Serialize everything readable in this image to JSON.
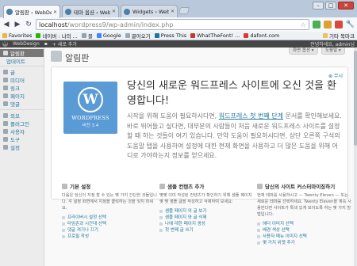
{
  "browser": {
    "tabs": [
      {
        "label": "알림판 ‹ WebDesign",
        "active": true
      },
      {
        "label": "테마 옵션 ‹ WebDe",
        "active": false
      },
      {
        "label": "Widgets ‹ WebDes",
        "active": false
      }
    ],
    "url_host": "localhost",
    "url_path": "/wordpress9/wp-admin/index.php",
    "bookmarks": [
      {
        "label": "Favorites",
        "color": "#e8b63a"
      },
      {
        "label": "네이버 : 나의 ...",
        "color": "#2db400"
      },
      {
        "label": "블",
        "color": "#8fa1b3"
      },
      {
        "label": "Google",
        "color": "#4285f4"
      },
      {
        "label": "끌어오기",
        "color": "#9aa6b2"
      },
      {
        "label": "Press This",
        "color": "#21759b"
      },
      {
        "label": "WhatTheFont! ...",
        "color": "#c0392b"
      },
      {
        "label": "dafont.com",
        "color": "#d63b2f"
      }
    ],
    "other_bookmarks": "기타 북마크"
  },
  "adminbar": {
    "site": "WebDesign",
    "new": "+ 새로 추가",
    "greeting": "안녕하세요, admin님"
  },
  "sidebar": {
    "dashboard": "알림판",
    "updates": "업데이트",
    "items": [
      "글",
      "미디어",
      "링크",
      "페이지",
      "댓글"
    ],
    "items2": [
      "외모",
      "플러그인",
      "사용자",
      "도구",
      "설정"
    ]
  },
  "header": {
    "title": "알림판",
    "screen_options": "화면 옵션 ▾",
    "help": "도움말 ▾"
  },
  "welcome": {
    "dismiss": "⊗ 무시",
    "logo_name": "WORDPRESS",
    "logo_version": "버전 3.4",
    "title": "당신의 새로운 워드프레스 사이트에 오신 것을 환영합니다!",
    "about_1": "시작을 위해 도움이 필요하시다면, ",
    "about_link": "워드프레스 첫 번째 단계",
    "about_2": " 문서를 확인해보세요. 바로 뛰어들고 싶다면, 대부분의 사람들이 처음 새로운 워드프레스 사이트를 설정할 때 하는 것들이 여기 있습니다. 만약 도움이 필요하시다면, 상단 오른쪽 구석의 도움말 탭을 사용하여 설정에 대한 현재 화면을 사용하고 더 많은 도움을 위해 어디로 가야하는지 정보를 얻으세요."
  },
  "columns": [
    {
      "title": "기본 설정",
      "text": "다음은 당신이 지정 할 수 있는 몇 가지 간단한 것들입니다. 각 설정 화면에서 지정을 클릭하는 것을 잊지 마세요.",
      "links": [
        "프라이버시 설정 선택",
        "타임존과 시간대 선택",
        "댓글 켜기나 끄기",
        "프로필 작성"
      ]
    },
    {
      "title": "샘플 컨텐츠 추가",
      "text": "몇몇 이미 작성된 컨텐츠가 확인하기 위해 샘플 페이지 몇 몇 샘플 글을 작성하고 삭제하여 보세요:",
      "links": [
        "샘플 페이지 의 글 보기",
        "샘플 페이지 와 글 삭제",
        "나에 대한 페이지 생성",
        "첫 번째 글 쓰기"
      ]
    },
    {
      "title": "당신의 사이트 커스터마이징하기",
      "text": "현재 테마를 사용하시고 — Twenty Eleven — 또는 새로운 테마를 선택하세요. Twenty Eleven을 계속 사용한다면 사이트가 특색 있게 보이도록 하는 몇 가지 방법입니다:",
      "links": [
        "헤더 이미지 선택",
        "배경 색상 선택",
        "사용자 메뉴 이미지 선택",
        "몇 가지 위젯 추가"
      ]
    }
  ]
}
